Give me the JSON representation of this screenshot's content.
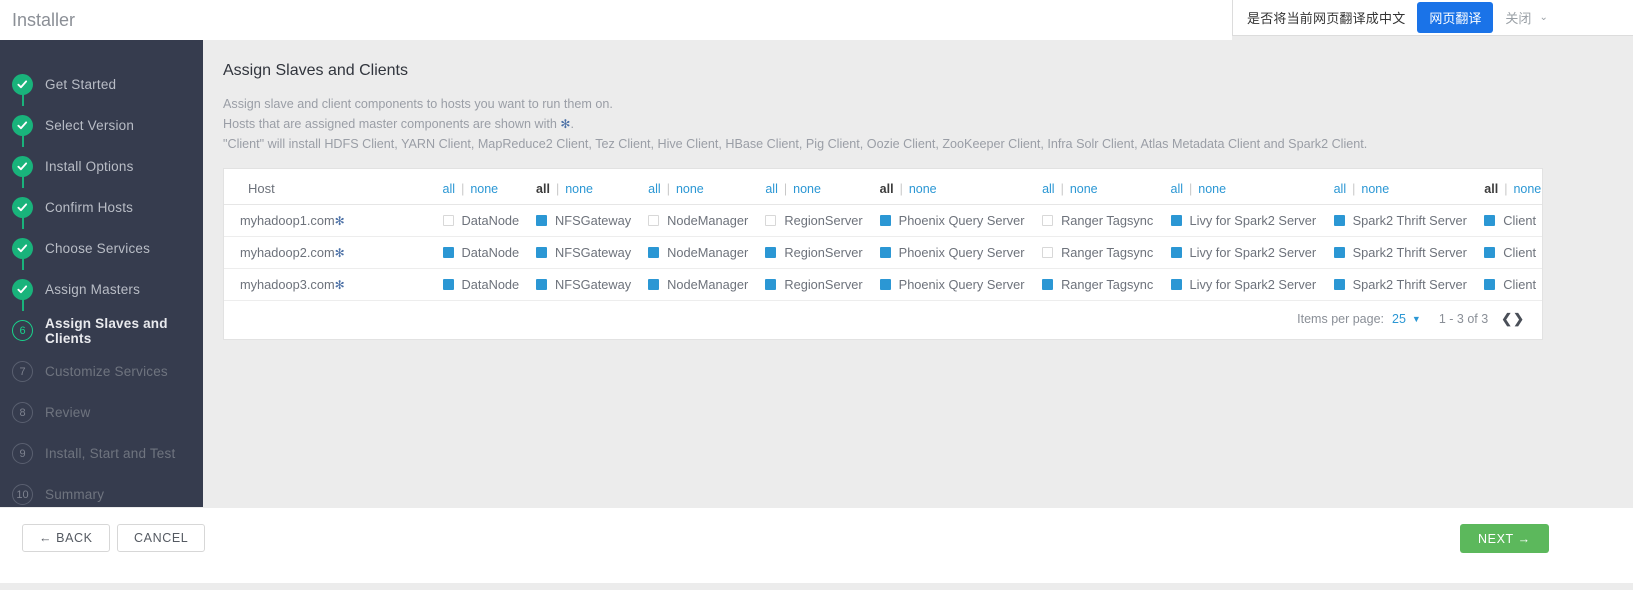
{
  "titlebar": {
    "title": "Installer"
  },
  "translate_bar": {
    "message": "是否将当前网页翻译成中文",
    "translate_button": "网页翻译",
    "close_label": "关闭",
    "caret": "⌄",
    "accent": "#1a73e8"
  },
  "sidebar": {
    "items": [
      {
        "num": "1",
        "label": "Get Started",
        "state": "done"
      },
      {
        "num": "2",
        "label": "Select Version",
        "state": "done"
      },
      {
        "num": "3",
        "label": "Install Options",
        "state": "done"
      },
      {
        "num": "4",
        "label": "Confirm Hosts",
        "state": "done"
      },
      {
        "num": "5",
        "label": "Choose Services",
        "state": "done"
      },
      {
        "num": "6",
        "label": "Assign Masters",
        "state": "done"
      },
      {
        "num": "6",
        "label": "Assign Slaves and Clients",
        "state": "current"
      },
      {
        "num": "7",
        "label": "Customize Services",
        "state": "todo"
      },
      {
        "num": "8",
        "label": "Review",
        "state": "todo"
      },
      {
        "num": "9",
        "label": "Install, Start and Test",
        "state": "todo"
      },
      {
        "num": "10",
        "label": "Summary",
        "state": "todo"
      }
    ],
    "done_color": "#19b37b",
    "current_color": "#19d38c",
    "background": "#363c4e"
  },
  "main": {
    "page_title": "Assign Slaves and Clients",
    "description_lines": [
      "Assign slave and client components to hosts you want to run them on.",
      "Hosts that are assigned master components are shown with ",
      "\"Client\" will install HDFS Client, YARN Client, MapReduce2 Client, Tez Client, Hive Client, HBase Client, Pig Client, Oozie Client, ZooKeeper Client, Infra Solr Client, Atlas Metadata Client and Spark2 Client."
    ],
    "master_marker": "✻",
    "description_line2_suffix": "."
  },
  "table": {
    "host_header": "Host",
    "all_label": "all",
    "none_label": "none",
    "separator": "|",
    "columns": [
      {
        "name": "DataNode",
        "all_active": false
      },
      {
        "name": "NFSGateway",
        "all_active": true
      },
      {
        "name": "NodeManager",
        "all_active": false
      },
      {
        "name": "RegionServer",
        "all_active": false
      },
      {
        "name": "Phoenix Query Server",
        "all_active": true
      },
      {
        "name": "Ranger Tagsync",
        "all_active": false
      },
      {
        "name": "Livy for Spark2 Server",
        "all_active": false
      },
      {
        "name": "Spark2 Thrift Server",
        "all_active": false
      },
      {
        "name": "Client",
        "all_active": true
      }
    ],
    "rows": [
      {
        "host": "myhadoop1.com",
        "is_master": true,
        "checks": [
          false,
          true,
          false,
          false,
          true,
          false,
          true,
          true,
          true
        ]
      },
      {
        "host": "myhadoop2.com",
        "is_master": true,
        "checks": [
          true,
          true,
          true,
          true,
          true,
          false,
          true,
          true,
          true
        ]
      },
      {
        "host": "myhadoop3.com",
        "is_master": true,
        "checks": [
          true,
          true,
          true,
          true,
          true,
          true,
          true,
          true,
          true
        ]
      }
    ],
    "checked_color": "#2b97d4"
  },
  "pagination": {
    "items_per_page_label": "Items per page:",
    "items_per_page_value": "25",
    "caret": "▼",
    "range_text": "1 - 3 of 3",
    "prev_arrow": "❮",
    "next_arrow": "❯"
  },
  "footer": {
    "back_label": "← BACK",
    "cancel_label": "CANCEL",
    "next_label": "NEXT →",
    "next_color": "#5cb85c"
  }
}
